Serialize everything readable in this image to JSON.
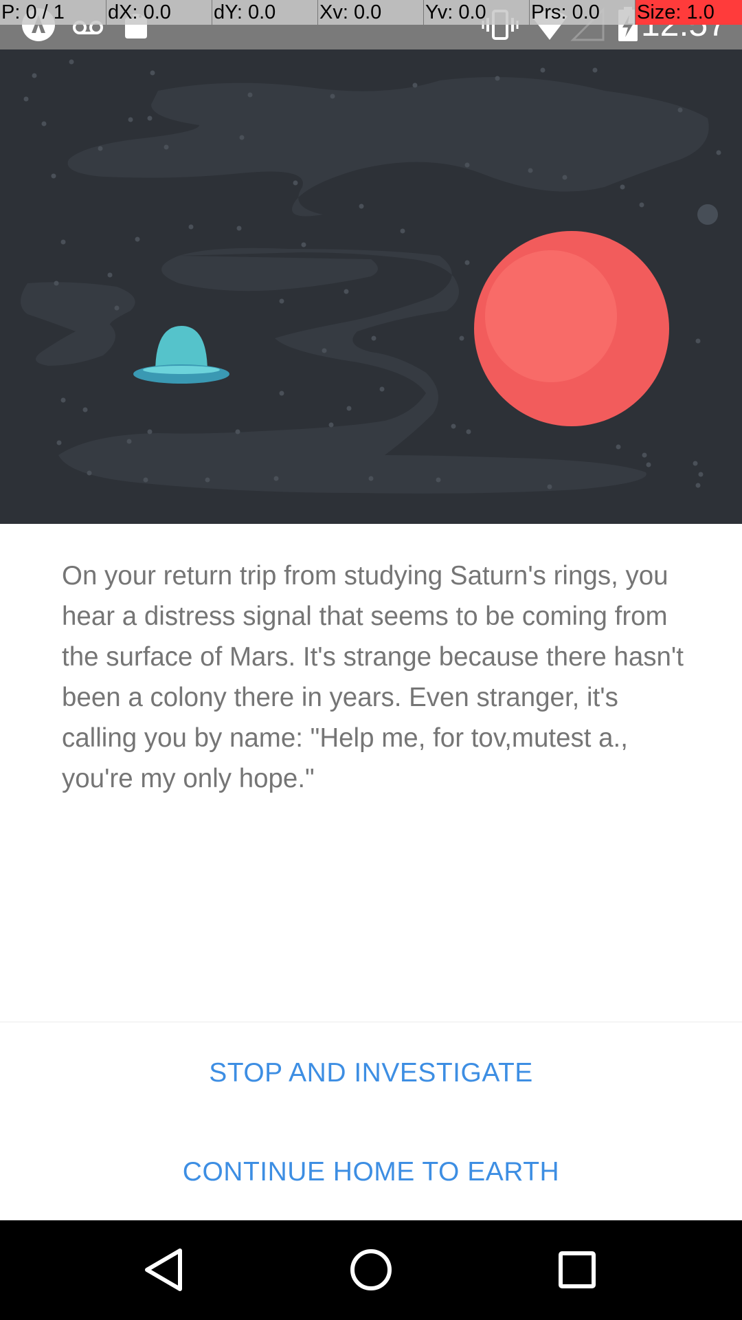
{
  "status_bar": {
    "time": "12:57",
    "icons": [
      "app-notification-icon",
      "voicemail-icon",
      "android-icon",
      "vibrate-icon",
      "wifi-icon",
      "cell-signal-icon",
      "battery-charging-icon"
    ]
  },
  "debug_overlay": {
    "pointer": "P: 0 / 1",
    "dx": "dX: 0.0",
    "dy": "dY: 0.0",
    "xv": "Xv: 0.0",
    "yv": "Yv: 0.0",
    "prs": "Prs: 0.0",
    "size": "Size: 1.0"
  },
  "story": {
    "text": "On your return trip from studying Saturn's rings, you hear a distress signal that seems to be coming from the surface of Mars. It's strange because there hasn't been a colony there in years. Even stranger, it's calling you by name: \"Help me, for tov,mutest a., you're my only hope.\""
  },
  "choices": [
    {
      "label": "STOP AND INVESTIGATE"
    },
    {
      "label": "CONTINUE HOME TO EARTH"
    }
  ],
  "nav_bar": {
    "buttons": [
      "back-icon",
      "home-icon",
      "recents-icon"
    ]
  },
  "colors": {
    "space_background": "#2d3137",
    "cloud": "#363b42",
    "star": "#4a5058",
    "planet": "#f25c5c",
    "planet_highlight": "#f86b68",
    "ufo_dome": "#55c3cb",
    "ufo_saucer": "#3a99b3",
    "accent_text": "#3d8ee3",
    "body_text": "#757575"
  }
}
